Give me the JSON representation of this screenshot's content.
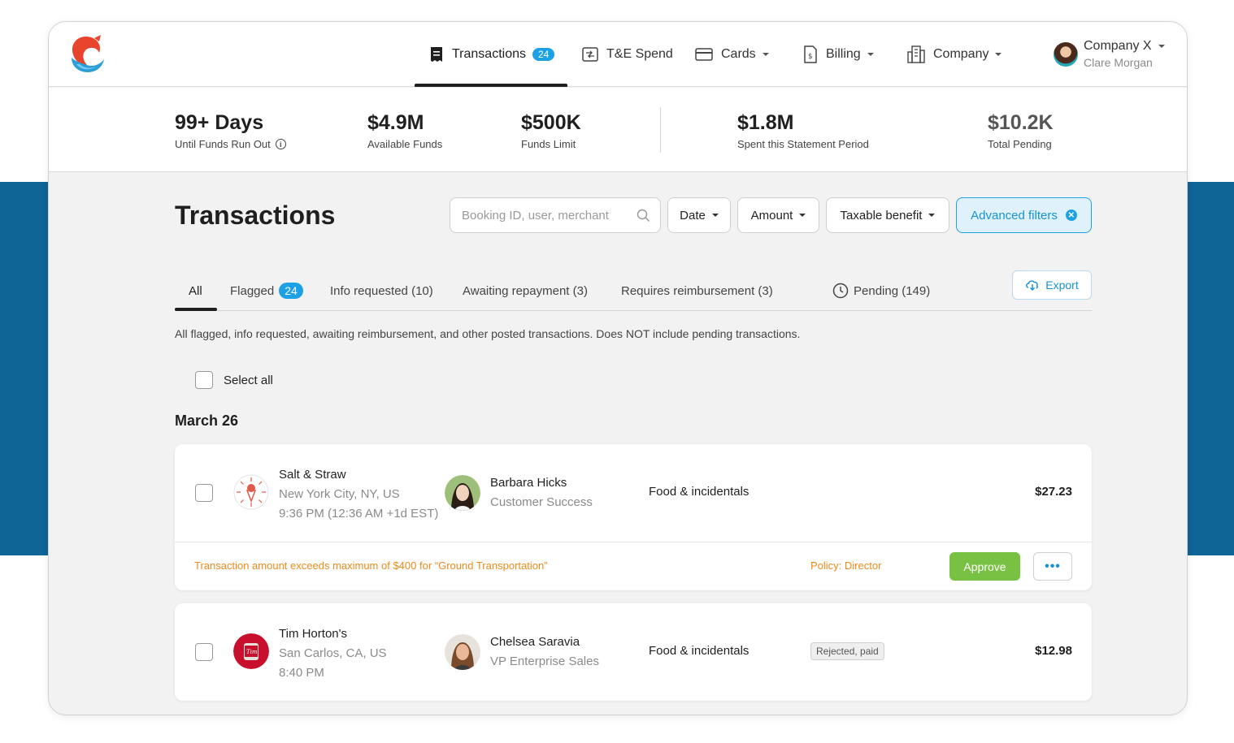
{
  "nav": {
    "items": [
      {
        "label": "Transactions",
        "badge": "24",
        "icon": "receipt-icon",
        "active": true
      },
      {
        "label": "T&E Spend",
        "icon": "transfer-icon"
      },
      {
        "label": "Cards",
        "icon": "card-icon"
      },
      {
        "label": "Billing",
        "icon": "invoice-icon"
      },
      {
        "label": "Company",
        "icon": "building-icon"
      }
    ],
    "user": {
      "company": "Company X",
      "name": "Clare Morgan"
    }
  },
  "stats": {
    "runway": {
      "value": "99+ Days",
      "label": "Until Funds Run Out"
    },
    "available": {
      "value": "$4.9M",
      "label": "Available Funds"
    },
    "limit": {
      "value": "$500K",
      "label": "Funds Limit"
    },
    "spent": {
      "value": "$1.8M",
      "label": "Spent this Statement Period"
    },
    "pending": {
      "value": "$10.2K",
      "label": "Total Pending"
    }
  },
  "page": {
    "title": "Transactions",
    "search_placeholder": "Booking ID, user, merchant",
    "filters": {
      "date": "Date",
      "amount": "Amount",
      "taxable": "Taxable benefit",
      "advanced": "Advanced filters"
    }
  },
  "tabs": {
    "all": "All",
    "flagged": "Flagged",
    "flagged_count": "24",
    "info_requested": "Info requested (10)",
    "awaiting_repayment": "Awaiting repayment (3)",
    "requires_reimbursement": "Requires reimbursement (3)",
    "pending": "Pending (149)",
    "export": "Export"
  },
  "description": "All flagged, info requested, awaiting reimbursement, and other posted transactions. Does NOT include pending transactions.",
  "select_all": "Select all",
  "date_heading": "March 26",
  "transactions": [
    {
      "merchant": "Salt & Straw",
      "location": "New York City, NY, US",
      "time": "9:36 PM (12:36 AM +1d EST)",
      "person": "Barbara Hicks",
      "department": "Customer Success",
      "category": "Food & incidentals",
      "amount": "$27.23",
      "warning": "Transaction amount exceeds maximum of $400 for “Ground Transportation”",
      "policy": "Policy: Director",
      "approve": "Approve",
      "more": "•••"
    },
    {
      "merchant": "Tim Horton's",
      "location": "San Carlos, CA, US",
      "time": "8:40 PM",
      "person": "Chelsea Saravia",
      "department": "VP Enterprise Sales",
      "category": "Food & incidentals",
      "status": "Rejected, paid",
      "amount": "$12.98"
    }
  ]
}
